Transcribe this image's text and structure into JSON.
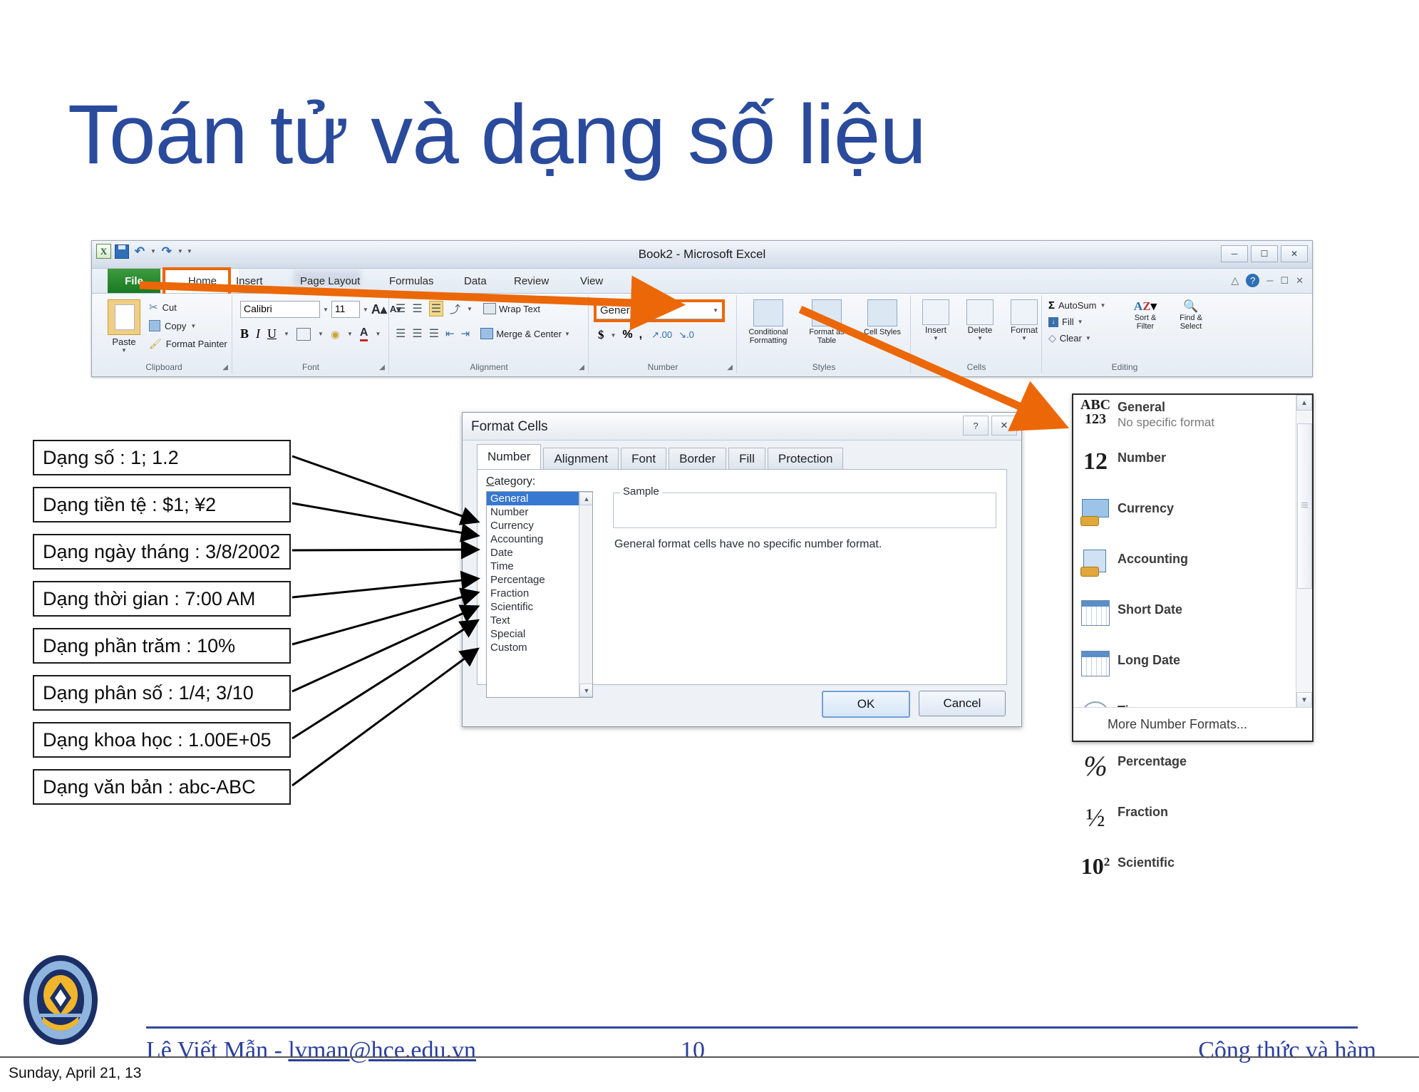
{
  "slide": {
    "title": "Toán tử và dạng số liệu",
    "page_number": "10",
    "footer_author": "Lê Viết Mẫn - ",
    "footer_email": "lvman@hce.edu.vn",
    "footer_right": "Công thức và hàm",
    "footer_date": "Sunday, April 21, 13"
  },
  "excel": {
    "window_title": "Book2  -  Microsoft Excel",
    "quick_access": [
      "excel-logo",
      "save-icon",
      "undo-icon",
      "redo-icon",
      "customize-icon"
    ],
    "window_buttons": [
      "minimize",
      "restore",
      "close"
    ],
    "tabs": [
      "File",
      "Home",
      "Insert",
      "Page Layout",
      "Formulas",
      "Data",
      "Review",
      "View"
    ],
    "highlighted_tab": "Home",
    "groups": {
      "clipboard": {
        "label": "Clipboard",
        "paste": "Paste",
        "items": [
          "Cut",
          "Copy",
          "Format Painter"
        ]
      },
      "font": {
        "label": "Font",
        "font_name": "Calibri",
        "font_size": "11",
        "buttons": [
          "B",
          "I",
          "U"
        ]
      },
      "alignment": {
        "label": "Alignment",
        "wrap_text": "Wrap Text",
        "merge_center": "Merge & Center"
      },
      "number": {
        "label": "Number",
        "format_value": "General",
        "buttons": [
          "$",
          "%",
          ",",
          "increase-decimal",
          "decrease-decimal"
        ]
      },
      "styles": {
        "label": "Styles",
        "items": [
          "Conditional Formatting",
          "Format as Table",
          "Cell Styles"
        ]
      },
      "cells": {
        "label": "Cells",
        "items": [
          "Insert",
          "Delete",
          "Format"
        ]
      },
      "editing": {
        "label": "Editing",
        "items": [
          "AutoSum",
          "Fill",
          "Clear",
          "Sort & Filter",
          "Find & Select"
        ]
      }
    }
  },
  "callouts": [
    "Dạng số : 1; 1.2",
    "Dạng tiền tệ : $1; ¥2",
    "Dạng ngày tháng : 3/8/2002",
    "Dạng thời gian : 7:00 AM",
    "Dạng phần trăm : 10%",
    "Dạng phân số : 1/4; 3/10",
    "Dạng khoa học : 1.00E+05",
    "Dạng văn bản : abc-ABC"
  ],
  "format_cells": {
    "title": "Format Cells",
    "titlebar_buttons": [
      "help",
      "close"
    ],
    "tabs": [
      "Number",
      "Alignment",
      "Font",
      "Border",
      "Fill",
      "Protection"
    ],
    "active_tab": "Number",
    "category_label": "Category:",
    "categories": [
      "General",
      "Number",
      "Currency",
      "Accounting",
      "Date",
      "Time",
      "Percentage",
      "Fraction",
      "Scientific",
      "Text",
      "Special",
      "Custom"
    ],
    "selected_category": "General",
    "sample_legend": "Sample",
    "sample_value": "",
    "description": "General format cells have no specific number format.",
    "ok_label": "OK",
    "cancel_label": "Cancel"
  },
  "number_format_menu": {
    "items": [
      {
        "name": "General",
        "sub": "No specific format",
        "icon": "abc123-icon"
      },
      {
        "name": "Number",
        "sub": "",
        "icon": "twelve-icon"
      },
      {
        "name": "Currency",
        "sub": "",
        "icon": "currency-icon"
      },
      {
        "name": "Accounting",
        "sub": "",
        "icon": "accounting-icon"
      },
      {
        "name": "Short Date",
        "sub": "",
        "icon": "calendar-icon"
      },
      {
        "name": "Long Date",
        "sub": "",
        "icon": "calendar-icon"
      },
      {
        "name": "Time",
        "sub": "",
        "icon": "clock-icon"
      },
      {
        "name": "Percentage",
        "sub": "",
        "icon": "percent-icon"
      },
      {
        "name": "Fraction",
        "sub": "",
        "icon": "half-icon"
      },
      {
        "name": "Scientific",
        "sub": "",
        "icon": "power-icon"
      }
    ],
    "more_label": "More Number Formats..."
  },
  "colors": {
    "title_blue": "#2a4a9c",
    "accent_orange": "#ec6707",
    "selection_blue": "#3778d0",
    "excel_green": "#177a21"
  }
}
